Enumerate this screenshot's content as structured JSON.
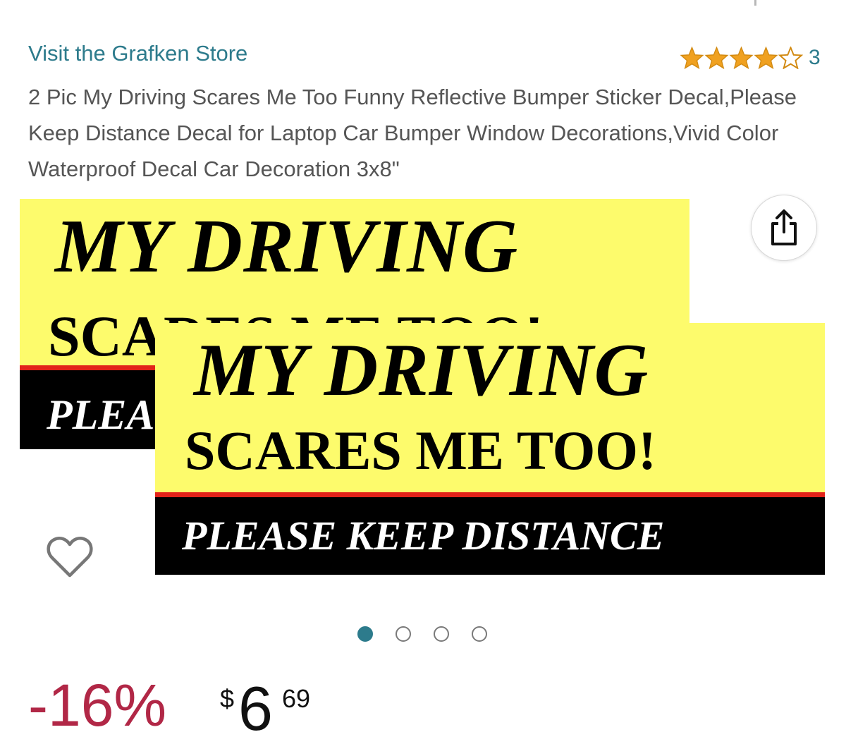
{
  "store": {
    "link_label": "Visit the Grafken Store"
  },
  "rating": {
    "stars": 4,
    "max_stars": 5,
    "count": "3",
    "star_color": "#f0a120"
  },
  "product": {
    "title": "2 Pic My Driving Scares Me Too Funny Reflective Bumper Sticker Decal,Please Keep Distance Decal for Laptop Car Bumper Window Decorations,Vivid Color Waterproof Decal Car Decoration 3x8\""
  },
  "gallery": {
    "sticker_back": {
      "line1": "MY DRIVING",
      "line2": "SCARES ME TOO!",
      "line3": "PLEASE KEEP DISTANCE"
    },
    "sticker_front": {
      "line1": "MY DRIVING",
      "line2": "SCARES ME TOO!",
      "line3": "PLEASE KEEP DISTANCE"
    },
    "active_index": 0,
    "total_images": 4,
    "share_icon": "share-icon",
    "wishlist_icon": "heart-icon"
  },
  "price": {
    "discount": "-16%",
    "currency_symbol": "$",
    "whole": "6",
    "fraction": "69",
    "discount_color": "#b12746"
  },
  "colors": {
    "link": "#2d7b8c",
    "sticker_yellow": "#fdfb6c",
    "sticker_red": "#e2231a"
  }
}
